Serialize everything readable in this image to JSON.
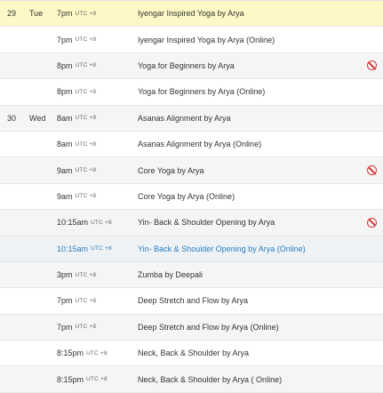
{
  "schedule": {
    "rows": [
      {
        "day_num": "29",
        "day_name": "Tue",
        "time": "7pm",
        "tz": "UTC +8",
        "title": "Iyengar Inspired Yoga by Arya",
        "cancelled": false
      },
      {
        "day_num": "",
        "day_name": "",
        "time": "7pm",
        "tz": "UTC +8",
        "title": "Iyengar Inspired Yoga by Arya (Online)",
        "cancelled": false
      },
      {
        "day_num": "",
        "day_name": "",
        "time": "8pm",
        "tz": "UTC +8",
        "title": "Yoga for Beginners by Arya",
        "cancelled": true
      },
      {
        "day_num": "",
        "day_name": "",
        "time": "8pm",
        "tz": "UTC +8",
        "title": "Yoga for Beginners by Arya (Online)",
        "cancelled": false
      },
      {
        "day_num": "30",
        "day_name": "Wed",
        "time": "8am",
        "tz": "UTC +8",
        "title": "Asanas Alignment by Arya",
        "cancelled": false
      },
      {
        "day_num": "",
        "day_name": "",
        "time": "8am",
        "tz": "UTC +8",
        "title": "Asanas Alignment by Arya (Online)",
        "cancelled": false
      },
      {
        "day_num": "",
        "day_name": "",
        "time": "9am",
        "tz": "UTC +8",
        "title": "Core Yoga by Arya",
        "cancelled": true
      },
      {
        "day_num": "",
        "day_name": "",
        "time": "9am",
        "tz": "UTC +8",
        "title": "Core Yoga by Arya (Online)",
        "cancelled": false
      },
      {
        "day_num": "",
        "day_name": "",
        "time": "10:15am",
        "tz": "UTC +8",
        "title": "Yin- Back & Shoulder Opening by Arya",
        "cancelled": true
      },
      {
        "day_num": "",
        "day_name": "",
        "time": "10:15am",
        "tz": "UTC +8",
        "title": "Yin- Back & Shoulder Opening by Arya (Online)",
        "cancelled": false
      },
      {
        "day_num": "",
        "day_name": "",
        "time": "3pm",
        "tz": "UTC +8",
        "title": "Zumba by Deepali",
        "cancelled": false
      },
      {
        "day_num": "",
        "day_name": "",
        "time": "7pm",
        "tz": "UTC +8",
        "title": "Deep Stretch and Flow by Arya",
        "cancelled": false
      },
      {
        "day_num": "",
        "day_name": "",
        "time": "7pm",
        "tz": "UTC +8",
        "title": "Deep Stretch and Flow by Arya (Online)",
        "cancelled": false
      },
      {
        "day_num": "",
        "day_name": "",
        "time": "8:15pm",
        "tz": "UTC +8",
        "title": "Neck, Back & Shoulder by Arya",
        "cancelled": false
      },
      {
        "day_num": "",
        "day_name": "",
        "time": "8:15pm",
        "tz": "UTC +8",
        "title": "Neck, Back & Shoulder by Arya ( Online)",
        "cancelled": false
      }
    ]
  },
  "icons": {
    "cancelled": "no-entry-icon"
  },
  "colors": {
    "highlight_row": "#fdf8c6",
    "hover_row": "#eef2f5",
    "link": "#2a7dbf",
    "cancel_icon": "#d43a3a"
  }
}
